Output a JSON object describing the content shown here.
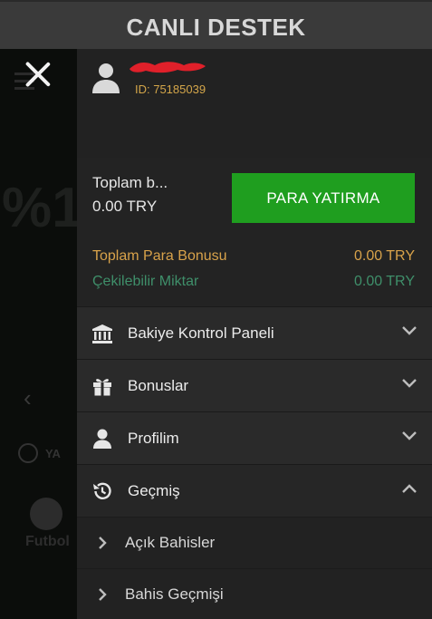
{
  "header": {
    "title": "CANLI DESTEK"
  },
  "background": {
    "promo_fragment": "%1",
    "side_text": "YA",
    "sport_label": "Futbol"
  },
  "user": {
    "id_label": "ID: 75185039"
  },
  "balance": {
    "total_label": "Toplam b...",
    "total_value": "0.00 TRY",
    "deposit_button": "PARA YATIRMA",
    "bonus_label": "Toplam Para Bonusu",
    "bonus_value": "0.00 TRY",
    "withdrawable_label": "Çekilebilir Miktar",
    "withdrawable_value": "0.00 TRY"
  },
  "menu": {
    "items": [
      {
        "label": "Bakiye Kontrol Paneli",
        "icon": "bank-icon",
        "expanded": false
      },
      {
        "label": "Bonuslar",
        "icon": "gift-icon",
        "expanded": false
      },
      {
        "label": "Profilim",
        "icon": "user-icon",
        "expanded": false
      },
      {
        "label": "Geçmiş",
        "icon": "history-icon",
        "expanded": true
      }
    ],
    "sub_items": [
      {
        "label": "Açık Bahisler"
      },
      {
        "label": "Bahis Geçmişi"
      }
    ]
  },
  "colors": {
    "accent_green": "#1f9e1f",
    "bonus_gold": "#d8a24a",
    "withdraw_green": "#3f8f6a",
    "id_gold": "#d4a64a"
  }
}
